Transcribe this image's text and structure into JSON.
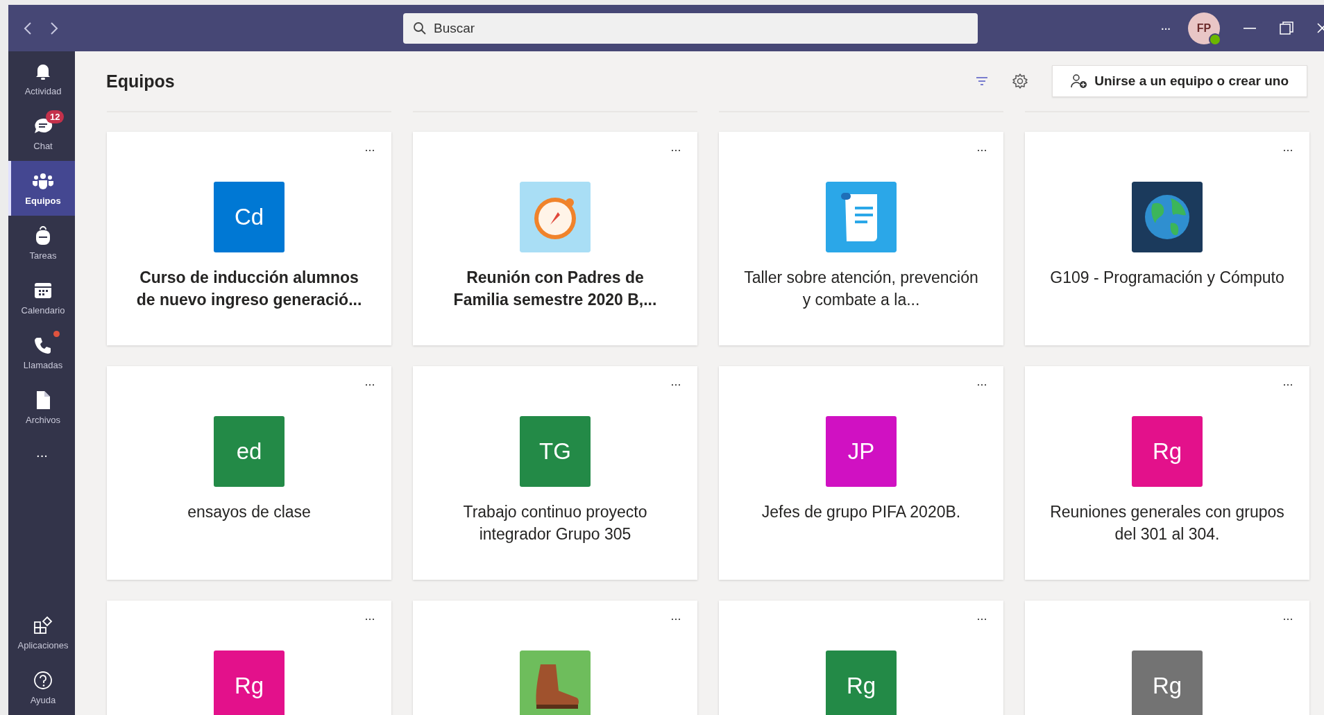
{
  "title_bar": {
    "search": {
      "placeholder": "Buscar"
    },
    "more": "···",
    "avatar": {
      "initials": "FP"
    }
  },
  "rail": {
    "items": [
      {
        "label": "Actividad",
        "selected": false
      },
      {
        "label": "Chat",
        "selected": false,
        "badge": "12"
      },
      {
        "label": "Equipos",
        "selected": true
      },
      {
        "label": "Tareas",
        "selected": false
      },
      {
        "label": "Calendario",
        "selected": false
      },
      {
        "label": "Llamadas",
        "selected": false,
        "dot": true
      },
      {
        "label": "Archivos",
        "selected": false
      }
    ],
    "more": "···",
    "bottom_items": [
      {
        "label": "Aplicaciones",
        "selected": false
      },
      {
        "label": "Ayuda",
        "selected": false
      }
    ]
  },
  "header": {
    "title": "Equipos",
    "join_button": "Unirse a un equipo o crear uno"
  },
  "teams": [
    {
      "kind": "initials",
      "initials": "Cd",
      "color": "#0078d4",
      "name": "Curso de inducción alumnos de nuevo ingreso generació...",
      "bold": true,
      "menu": "···"
    },
    {
      "kind": "compass",
      "name": "Reunión con Padres de Familia semestre 2020 B,...",
      "bold": true,
      "menu": "···"
    },
    {
      "kind": "scroll",
      "name": "Taller sobre atención, prevención y combate a la...",
      "bold": false,
      "menu": "···"
    },
    {
      "kind": "globe",
      "name": "G109 - Programación y Cómputo",
      "bold": false,
      "menu": "···"
    },
    {
      "kind": "initials",
      "initials": "ed",
      "color": "#238a47",
      "name": "ensayos de clase",
      "bold": false,
      "menu": "···"
    },
    {
      "kind": "initials",
      "initials": "TG",
      "color": "#238a47",
      "name": "Trabajo continuo proyecto integrador Grupo 305",
      "bold": false,
      "menu": "···"
    },
    {
      "kind": "initials",
      "initials": "JP",
      "color": "#d011c2",
      "name": "Jefes de grupo PIFA 2020B.",
      "bold": false,
      "menu": "···"
    },
    {
      "kind": "initials",
      "initials": "Rg",
      "color": "#e3118b",
      "name": "Reuniones generales con grupos del 301 al 304.",
      "bold": false,
      "menu": "···"
    },
    {
      "kind": "initials",
      "initials": "Rg",
      "color": "#e3118b",
      "menu": "···"
    },
    {
      "kind": "boot",
      "menu": "···"
    },
    {
      "kind": "initials",
      "initials": "Rg",
      "color": "#238a47",
      "menu": "···"
    },
    {
      "kind": "initials",
      "initials": "Rg",
      "color": "#737373",
      "menu": "···"
    }
  ]
}
